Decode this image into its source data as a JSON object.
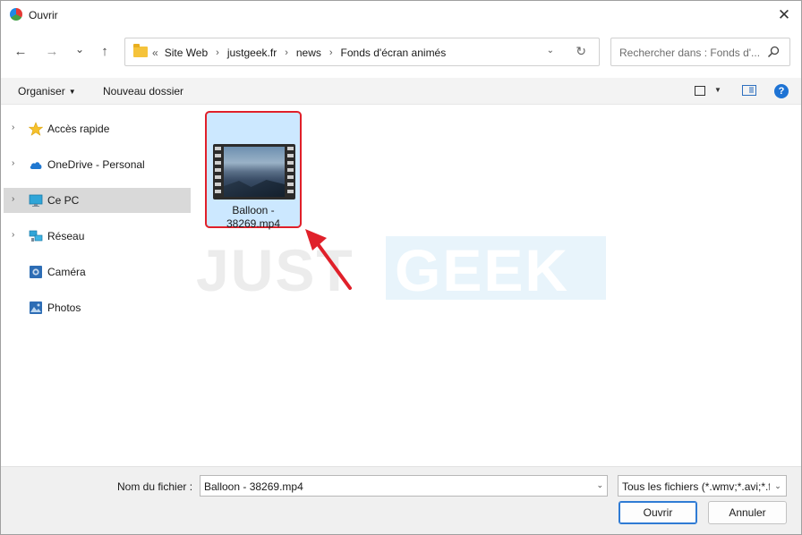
{
  "window": {
    "title": "Ouvrir",
    "close_glyph": "✕"
  },
  "nav": {
    "back_glyph": "←",
    "forward_glyph": "→",
    "recent_glyph": "⌄",
    "up_glyph": "↑",
    "address": {
      "overflow_glyph": "«",
      "crumbs": [
        "Site Web",
        "justgeek.fr",
        "news",
        "Fonds d'écran animés"
      ],
      "separator": "›",
      "dropdown_glyph": "⌄",
      "refresh_glyph": "↻"
    },
    "search": {
      "placeholder": "Rechercher dans : Fonds d'..."
    }
  },
  "toolbar": {
    "organize_label": "Organiser",
    "new_folder_label": "Nouveau dossier",
    "help_glyph": "?"
  },
  "sidebar": {
    "items": [
      {
        "label": "Accès rapide",
        "icon": "star-icon",
        "expandable": true
      },
      {
        "label": "OneDrive - Personal",
        "icon": "cloud-icon",
        "expandable": true
      },
      {
        "label": "Ce PC",
        "icon": "monitor-icon",
        "expandable": true,
        "selected": true
      },
      {
        "label": "Réseau",
        "icon": "network-icon",
        "expandable": true
      },
      {
        "label": "Caméra",
        "icon": "camera-icon",
        "expandable": false
      },
      {
        "label": "Photos",
        "icon": "photos-icon",
        "expandable": false
      }
    ],
    "chevron_glyph": "›"
  },
  "files": [
    {
      "name_line1": "Balloon -",
      "name_line2": "38269.mp4",
      "type": "video"
    }
  ],
  "watermark": {
    "part1": "JUST",
    "part2": "GEEK"
  },
  "footer": {
    "filename_label": "Nom du fichier :",
    "filename_value": "Balloon - 38269.mp4",
    "filter_value": "Tous les fichiers (*.wmv;*.avi;*.f",
    "open_label": "Ouvrir",
    "cancel_label": "Annuler",
    "caret_glyph": "⌄"
  },
  "colors": {
    "accent": "#2f7bd4",
    "selection": "#cce8ff",
    "highlight_border": "#e0202a",
    "arrow": "#e0202a"
  }
}
